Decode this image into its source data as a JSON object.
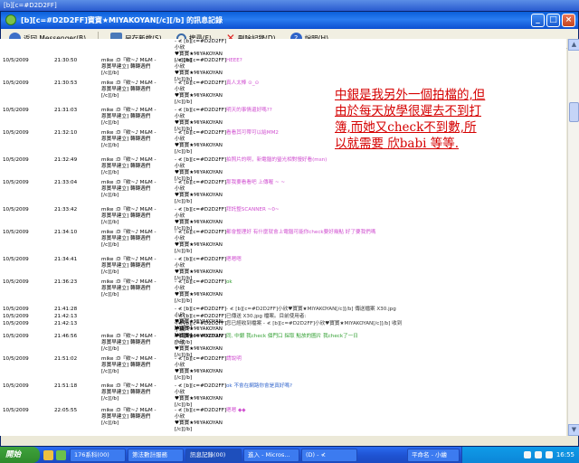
{
  "topstrip": {
    "text": "[b][c=#D2D2FF]"
  },
  "window": {
    "title": "[b][c=#D2D2FF]寶寶★MIYAKOYAN[/c][/b] 的訊息記錄",
    "buttons": {
      "min": "_",
      "max": "□",
      "close": "×"
    }
  },
  "toolbar": {
    "back": "返回 Messenger(B)",
    "save": "另存新檔(S)",
    "search": "搜尋(F)",
    "delete": "刪除記錄(D)",
    "help": "說明(H)"
  },
  "rows": [
    {
      "date": "",
      "time": "",
      "from": "",
      "to": "",
      "msg": ""
    },
    {
      "date": "10/5/2009",
      "time": "21:30:50",
      "msg": "HEEE?"
    },
    {
      "date": "10/5/2009",
      "time": "21:30:53",
      "msg": "真人太棒 ⊙_⊙"
    },
    {
      "date": "10/5/2009",
      "time": "21:31:03",
      "msg": "明天的事情還好嗎??"
    },
    {
      "date": "10/5/2009",
      "time": "21:32:10",
      "msg": "看看其可帶可以給MM2"
    },
    {
      "date": "10/5/2009",
      "time": "21:32:49",
      "msg": "拍照片的啊，新電腦的螢光相對慢好看(msn)"
    },
    {
      "date": "10/5/2009",
      "time": "21:33:04",
      "msg": "那我要看看吧 上傳喔 ~ ~"
    },
    {
      "date": "10/5/2009",
      "time": "21:33:42",
      "msg": "拜託整SCANNER ~0~"
    },
    {
      "date": "10/5/2009",
      "time": "21:34:10",
      "msg": "都會整理好 有什麼就會上電腦可能你check要好幾點 好了要我們嗎"
    },
    {
      "date": "10/5/2009",
      "time": "21:34:41",
      "msg": "嗯嗯嗯"
    },
    {
      "date": "10/5/2009",
      "time": "21:36:23",
      "msg": "ok"
    },
    {
      "date": "10/5/2009",
      "time": "21:41:28",
      "msg": "- ≮ [b][c=#D2D2FF]小欣♥寶寶★MIYAKOYAN[/c][/b] 傳送檔案 X30.jpg"
    },
    {
      "date": "10/5/2009",
      "time": "21:42:13",
      "msg": "已傳送 X30.jpg 檔案。目前使用者: "
    },
    {
      "date": "10/5/2009",
      "time": "21:42:13",
      "msg": "您已經收到檔案 - ≮ [b][c=#D2D2FF]小欣♥寶寶★MIYAKOYAN[/c][/b] 收到"
    },
    {
      "date": "10/5/2009",
      "time": "21:46:56",
      "msg": "同, 中銀 我check 個門口 採取 點放的圖片 我check了一日"
    },
    {
      "date": "10/5/2009",
      "time": "21:51:02",
      "msg": "請說明"
    },
    {
      "date": "10/5/2009",
      "time": "21:51:18",
      "msg": "ok 不會在網路你會是真好嗎?"
    },
    {
      "date": "10/5/2009",
      "time": "22:05:55",
      "msg": "嗯嗯 ◆◆"
    }
  ],
  "sender": {
    "line1": "mike :D『欸~♪ M&M -",
    "line2": "恩寶早建立]  轉轉週們"
  },
  "receiver": {
    "line1": "- ≮ [b][c=#D2D2FF]小欣",
    "line2": "♥寶寶★MIYAKOYAN",
    "line3": "[/c][/b]"
  },
  "annotation": "中銀是我另外一個拍檔的,但由於每天放學很遲去不到打簿,而她又check不到數,所以就需要 欣babi 等等.",
  "taskbar": {
    "start": "開始",
    "tasks": [
      "176系科(00)",
      "第法數計服務",
      "訊息記錄(00)",
      "進入 - Micros...",
      "(D) - ≮"
    ],
    "tray_task": "平命名 - 小繪",
    "clock": "16:55"
  }
}
